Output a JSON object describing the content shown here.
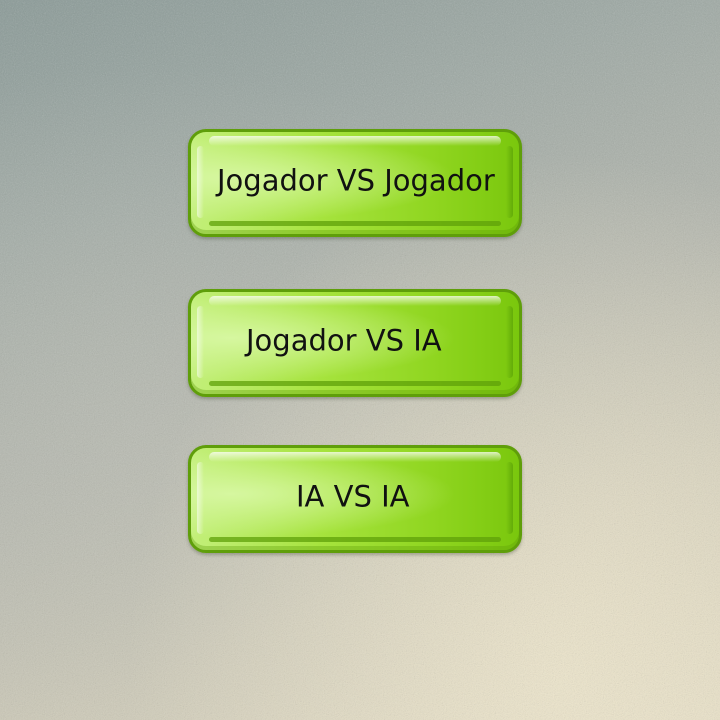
{
  "menu": {
    "buttons": [
      {
        "label": "Jogador VS Jogador"
      },
      {
        "label": "Jogador VS IA"
      },
      {
        "label": "IA VS IA"
      }
    ]
  },
  "colors": {
    "button_fill": "#a6e33d",
    "button_border": "#5f9e0a",
    "background_top": "#8a9a97",
    "background_bottom": "#e4dcc3"
  }
}
